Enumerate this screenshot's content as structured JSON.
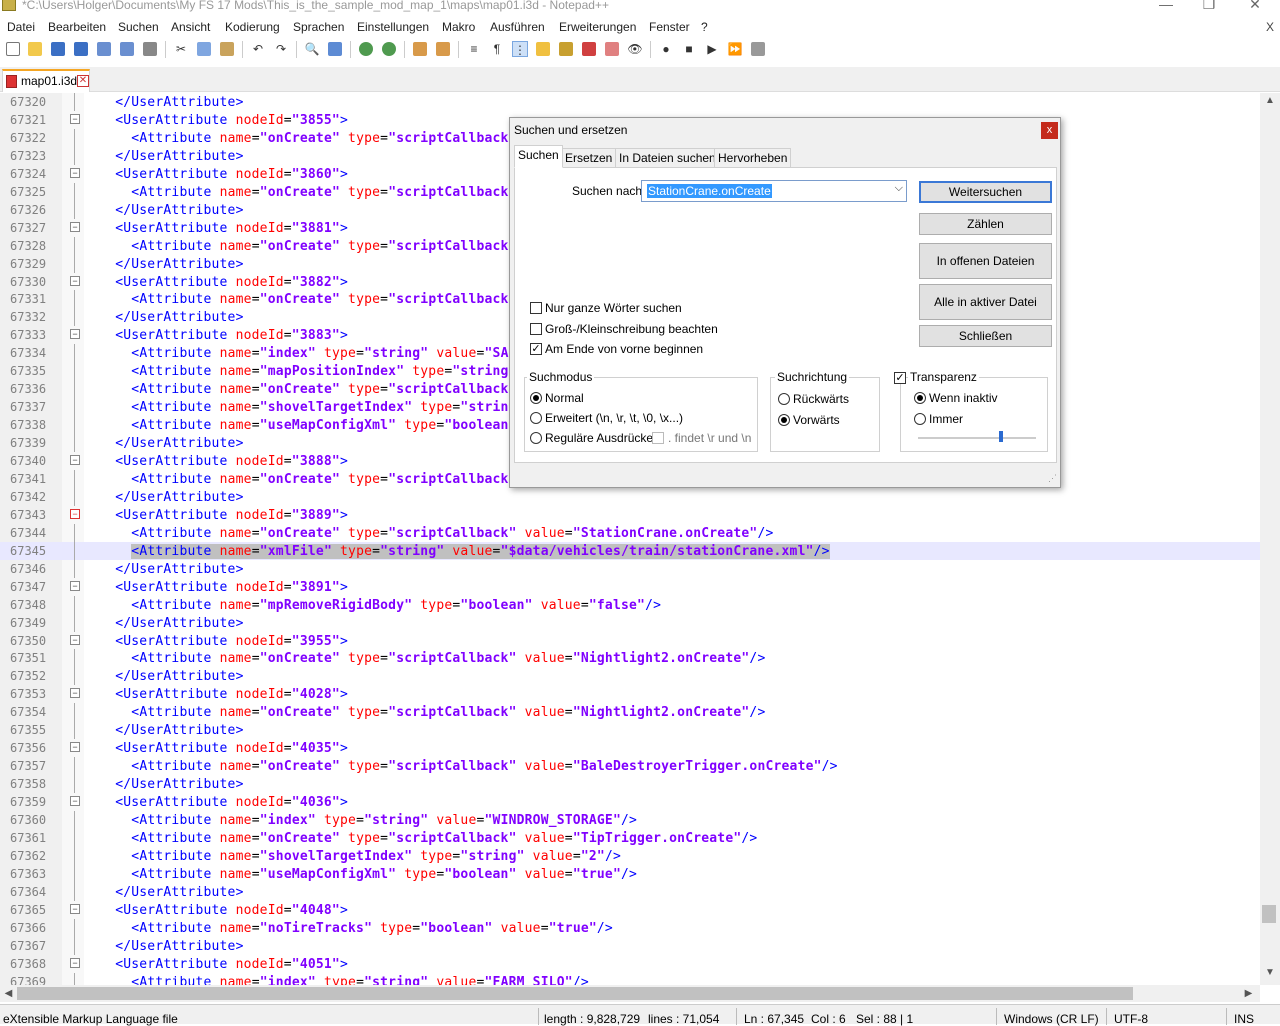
{
  "window": {
    "title": "*C:\\Users\\Holger\\Documents\\My FS 17 Mods\\This_is_the_sample_mod_map_1\\maps\\map01.i3d - Notepad++"
  },
  "menu": [
    "Datei",
    "Bearbeiten",
    "Suchen",
    "Ansicht",
    "Kodierung",
    "Sprachen",
    "Einstellungen",
    "Makro",
    "Ausführen",
    "Erweiterungen",
    "Fenster",
    "?"
  ],
  "menu_close": "X",
  "tab": {
    "label": "map01.i3d",
    "close": "✕"
  },
  "editor": {
    "lines": [
      {
        "n": "67320",
        "indent": 2,
        "kind": "close"
      },
      {
        "n": "67321",
        "indent": 2,
        "kind": "open",
        "node": "3855"
      },
      {
        "n": "67322",
        "indent": 3,
        "kind": "attr",
        "name": "onCreate",
        "type": "scriptCallback"
      },
      {
        "n": "67323",
        "indent": 2,
        "kind": "close"
      },
      {
        "n": "67324",
        "indent": 2,
        "kind": "open",
        "node": "3860"
      },
      {
        "n": "67325",
        "indent": 3,
        "kind": "attr",
        "name": "onCreate",
        "type": "scriptCallback"
      },
      {
        "n": "67326",
        "indent": 2,
        "kind": "close"
      },
      {
        "n": "67327",
        "indent": 2,
        "kind": "open",
        "node": "3881"
      },
      {
        "n": "67328",
        "indent": 3,
        "kind": "attr",
        "name": "onCreate",
        "type": "scriptCallback"
      },
      {
        "n": "67329",
        "indent": 2,
        "kind": "close"
      },
      {
        "n": "67330",
        "indent": 2,
        "kind": "open",
        "node": "3882"
      },
      {
        "n": "67331",
        "indent": 3,
        "kind": "attr",
        "name": "onCreate",
        "type": "scriptCallback"
      },
      {
        "n": "67332",
        "indent": 2,
        "kind": "close"
      },
      {
        "n": "67333",
        "indent": 2,
        "kind": "open",
        "node": "3883"
      },
      {
        "n": "67334",
        "indent": 3,
        "kind": "attr",
        "name": "index",
        "type": "string",
        "value": "SAI"
      },
      {
        "n": "67335",
        "indent": 3,
        "kind": "attr",
        "name": "mapPositionIndex",
        "type": "string"
      },
      {
        "n": "67336",
        "indent": 3,
        "kind": "attr",
        "name": "onCreate",
        "type": "scriptCallback"
      },
      {
        "n": "67337",
        "indent": 3,
        "kind": "attr",
        "name": "shovelTargetIndex",
        "type": "string"
      },
      {
        "n": "67338",
        "indent": 3,
        "kind": "attr",
        "name": "useMapConfigXml",
        "type": "boolean"
      },
      {
        "n": "67339",
        "indent": 2,
        "kind": "close"
      },
      {
        "n": "67340",
        "indent": 2,
        "kind": "open",
        "node": "3888"
      },
      {
        "n": "67341",
        "indent": 3,
        "kind": "attr",
        "name": "onCreate",
        "type": "scriptCallback"
      },
      {
        "n": "67342",
        "indent": 2,
        "kind": "close"
      },
      {
        "n": "67343",
        "indent": 2,
        "kind": "open",
        "node": "3889",
        "unfolded": true
      },
      {
        "n": "67344",
        "indent": 3,
        "kind": "attr",
        "name": "onCreate",
        "type": "scriptCallback",
        "value": "StationCrane.onCreate",
        "end": "/>"
      },
      {
        "n": "67345",
        "indent": 3,
        "kind": "attr",
        "name": "xmlFile",
        "type": "string",
        "value": "$data/vehicles/train/stationCrane.xml",
        "end": "/>",
        "current": true
      },
      {
        "n": "67346",
        "indent": 2,
        "kind": "close"
      },
      {
        "n": "67347",
        "indent": 2,
        "kind": "open",
        "node": "3891"
      },
      {
        "n": "67348",
        "indent": 3,
        "kind": "attr",
        "name": "mpRemoveRigidBody",
        "type": "boolean",
        "value": "false",
        "end": "/>"
      },
      {
        "n": "67349",
        "indent": 2,
        "kind": "close"
      },
      {
        "n": "67350",
        "indent": 2,
        "kind": "open",
        "node": "3955"
      },
      {
        "n": "67351",
        "indent": 3,
        "kind": "attr",
        "name": "onCreate",
        "type": "scriptCallback",
        "value": "Nightlight2.onCreate",
        "end": "/>"
      },
      {
        "n": "67352",
        "indent": 2,
        "kind": "close"
      },
      {
        "n": "67353",
        "indent": 2,
        "kind": "open",
        "node": "4028"
      },
      {
        "n": "67354",
        "indent": 3,
        "kind": "attr",
        "name": "onCreate",
        "type": "scriptCallback",
        "value": "Nightlight2.onCreate",
        "end": "/>"
      },
      {
        "n": "67355",
        "indent": 2,
        "kind": "close"
      },
      {
        "n": "67356",
        "indent": 2,
        "kind": "open",
        "node": "4035"
      },
      {
        "n": "67357",
        "indent": 3,
        "kind": "attr",
        "name": "onCreate",
        "type": "scriptCallback",
        "value": "BaleDestroyerTrigger.onCreate",
        "end": "/>"
      },
      {
        "n": "67358",
        "indent": 2,
        "kind": "close"
      },
      {
        "n": "67359",
        "indent": 2,
        "kind": "open",
        "node": "4036"
      },
      {
        "n": "67360",
        "indent": 3,
        "kind": "attr",
        "name": "index",
        "type": "string",
        "value": "WINDROW_STORAGE",
        "end": "/>"
      },
      {
        "n": "67361",
        "indent": 3,
        "kind": "attr",
        "name": "onCreate",
        "type": "scriptCallback",
        "value": "TipTrigger.onCreate",
        "end": "/>"
      },
      {
        "n": "67362",
        "indent": 3,
        "kind": "attr",
        "name": "shovelTargetIndex",
        "type": "string",
        "value": "2",
        "end": "/>"
      },
      {
        "n": "67363",
        "indent": 3,
        "kind": "attr",
        "name": "useMapConfigXml",
        "type": "boolean",
        "value": "true",
        "end": "/>"
      },
      {
        "n": "67364",
        "indent": 2,
        "kind": "close"
      },
      {
        "n": "67365",
        "indent": 2,
        "kind": "open",
        "node": "4048"
      },
      {
        "n": "67366",
        "indent": 3,
        "kind": "attr",
        "name": "noTireTracks",
        "type": "boolean",
        "value": "true",
        "end": "/>"
      },
      {
        "n": "67367",
        "indent": 2,
        "kind": "close"
      },
      {
        "n": "67368",
        "indent": 2,
        "kind": "open",
        "node": "4051"
      },
      {
        "n": "67369",
        "indent": 3,
        "kind": "attr",
        "name": "index",
        "type": "string",
        "value": "FARM_SILO",
        "end": "/>"
      }
    ]
  },
  "dialog": {
    "title": "Suchen und ersetzen",
    "close": "x",
    "tabs": [
      "Suchen",
      "Ersetzen",
      "In Dateien suchen",
      "Hervorheben"
    ],
    "find_label": "Suchen nach:",
    "find_value": "StationCrane.onCreate",
    "buttons": {
      "find_next": "Weitersuchen",
      "count": "Zählen",
      "find_all_open": "In offenen Dateien suchen",
      "find_all_current": "Alle in aktiver Datei suchen",
      "close": "Schließen"
    },
    "options": {
      "whole_word": "Nur ganze Wörter suchen",
      "match_case": "Groß-/Kleinschreibung beachten",
      "wrap": "Am Ende von vorne beginnen"
    },
    "mode": {
      "title": "Suchmodus",
      "normal": "Normal",
      "extended": "Erweitert (\\n, \\r, \\t, \\0, \\x...)",
      "regex": "Reguläre Ausdrücke",
      "dotall": ". findet \\r und \\n"
    },
    "direction": {
      "title": "Suchrichtung",
      "up": "Rückwärts",
      "down": "Vorwärts"
    },
    "transparency": {
      "title": "Transparenz",
      "on_lose_focus": "Wenn inaktiv",
      "always": "Immer",
      "level": 0.7
    }
  },
  "status": {
    "file_type": "eXtensible Markup Language file",
    "length": "length : 9,828,729",
    "lines": "lines : 71,054",
    "ln": "Ln : 67,345",
    "col": "Col : 6",
    "sel": "Sel : 88 | 1",
    "eol": "Windows (CR LF)",
    "encoding": "UTF-8",
    "mode": "INS"
  }
}
